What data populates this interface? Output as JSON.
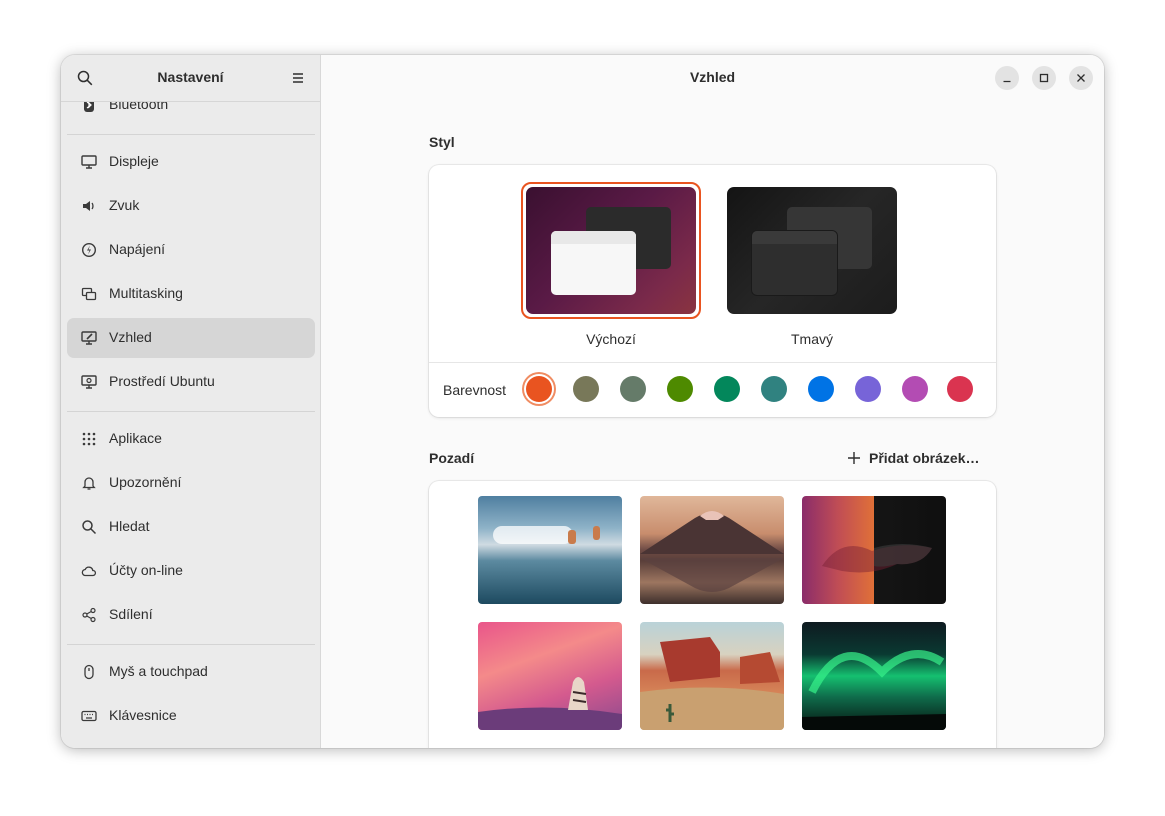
{
  "sidebar": {
    "title": "Nastavení",
    "search_icon": "search-icon",
    "menu_icon": "hamburger-menu-icon",
    "items": [
      {
        "label": "Bluetooth",
        "icon": "bluetooth-icon"
      },
      {
        "label": "Displeje",
        "icon": "display-icon"
      },
      {
        "label": "Zvuk",
        "icon": "speaker-icon"
      },
      {
        "label": "Napájení",
        "icon": "power-icon"
      },
      {
        "label": "Multitasking",
        "icon": "multitasking-icon"
      },
      {
        "label": "Vzhled",
        "icon": "appearance-icon",
        "active": true
      },
      {
        "label": "Prostředí Ubuntu",
        "icon": "ubuntu-desktop-icon"
      },
      {
        "label": "Aplikace",
        "icon": "apps-grid-icon"
      },
      {
        "label": "Upozornění",
        "icon": "bell-icon"
      },
      {
        "label": "Hledat",
        "icon": "search-icon"
      },
      {
        "label": "Účty on-line",
        "icon": "cloud-icon"
      },
      {
        "label": "Sdílení",
        "icon": "share-icon"
      },
      {
        "label": "Myš a touchpad",
        "icon": "mouse-icon"
      },
      {
        "label": "Klávesnice",
        "icon": "keyboard-icon"
      }
    ]
  },
  "header": {
    "title": "Vzhled",
    "minimize_icon": "minimize-icon",
    "maximize_icon": "maximize-icon",
    "close_icon": "close-icon"
  },
  "style_section": {
    "title": "Styl",
    "options": [
      {
        "label": "Výchozí",
        "selected": true
      },
      {
        "label": "Tmavý",
        "selected": false
      }
    ],
    "accent_label": "Barevnost",
    "accent_colors": [
      "#e95420",
      "#787859",
      "#657b69",
      "#4e8a00",
      "#03875b",
      "#308280",
      "#0073e5",
      "#7764d8",
      "#b34cb3",
      "#da3450"
    ],
    "accent_selected": "#e95420"
  },
  "background_section": {
    "title": "Pozadí",
    "add_label": "Přidat obrázek…",
    "add_icon": "plus-icon",
    "wallpapers": [
      "wallpaper-sky-reflection",
      "wallpaper-mountain-lake",
      "wallpaper-numbat-light-dark",
      "wallpaper-numbat-pink",
      "wallpaper-desert-canyon",
      "wallpaper-aurora"
    ]
  }
}
